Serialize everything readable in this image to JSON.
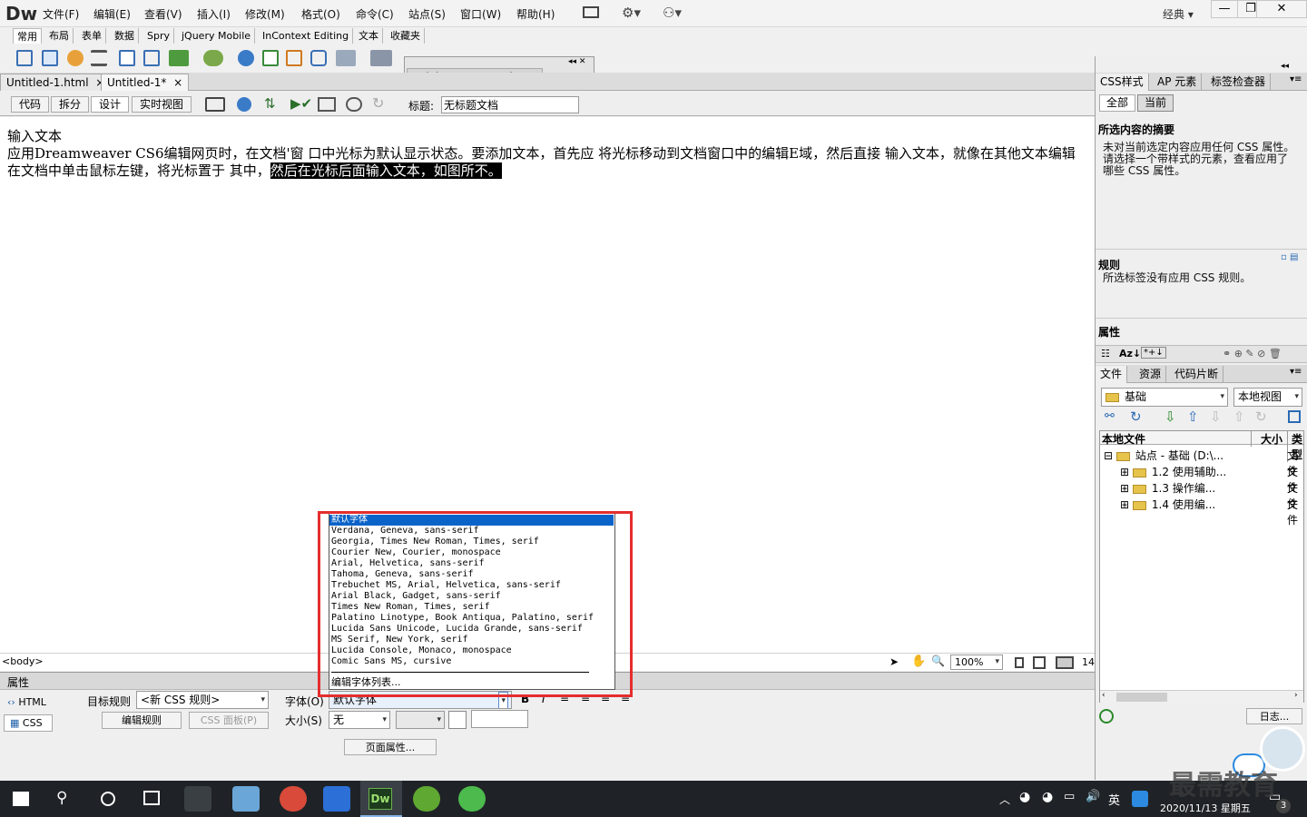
{
  "app": {
    "logo": "Dw",
    "workspace": "经典"
  },
  "menu": [
    "文件(F)",
    "编辑(E)",
    "查看(V)",
    "插入(I)",
    "修改(M)",
    "格式(O)",
    "命令(C)",
    "站点(S)",
    "窗口(W)",
    "帮助(H)"
  ],
  "insert_tabs": [
    "常用",
    "布局",
    "表单",
    "数据",
    "Spry",
    "jQuery Mobile",
    "InContext Editing",
    "文本",
    "收藏夹"
  ],
  "browserlab": "Adobe BrowserLab",
  "doc_tabs": [
    {
      "label": "Untitled-1.html",
      "close": "×"
    },
    {
      "label": "Untitled-1*",
      "close": "×"
    }
  ],
  "views": [
    "代码",
    "拆分",
    "设计",
    "实时视图"
  ],
  "title_label": "标题:",
  "title_value": "无标题文档",
  "document": {
    "line1": "输入文本",
    "line2": "应用Dreamweaver CS6编辑网页时，在文档'窗 口中光标为默认显示状态。要添加文本，首先应 将光标移动到文档窗口中的编辑E域，然后直接 输入文本，就像在其他文本编辑",
    "line3_a": "在文档中单击鼠标左键，将光标置于 其中，",
    "line3_selected": "然后在光标后面输入文本，如图所不。 "
  },
  "status": {
    "tag": "<body>",
    "zoom": "100%",
    "size": "14"
  },
  "properties": {
    "header": "属性",
    "html_btn": "HTML",
    "css_btn": "CSS",
    "target_rule_label": "目标规则",
    "target_rule_value": "<新 CSS 规则>",
    "edit_rule": "编辑规则",
    "css_panel": "CSS 面板(P)",
    "font_label": "字体(O)",
    "font_value": "默认字体",
    "size_label": "大小(S)",
    "size_value": "无",
    "page_props": "页面属性..."
  },
  "font_dropdown": {
    "selected": "默认字体",
    "options": [
      "Verdana, Geneva, sans-serif",
      "Georgia, Times New Roman, Times, serif",
      "Courier New, Courier, monospace",
      "Arial, Helvetica, sans-serif",
      "Tahoma, Geneva, sans-serif",
      "Trebuchet MS, Arial, Helvetica, sans-serif",
      "Arial Black, Gadget, sans-serif",
      "Times New Roman, Times, serif",
      "Palatino Linotype, Book Antiqua, Palatino, serif",
      "Lucida Sans Unicode, Lucida Grande, sans-serif",
      "MS Serif, New York, serif",
      "Lucida Console, Monaco, monospace",
      "Comic Sans MS, cursive"
    ],
    "edit_list": "编辑字体列表..."
  },
  "css_panel": {
    "tabs": [
      "CSS样式",
      "AP 元素",
      "标签检查器"
    ],
    "mode_tabs": [
      "全部",
      "当前"
    ],
    "summary_title": "所选内容的摘要",
    "summary_text": [
      "未对当前选定内容应用任何 CSS 属性。",
      "请选择一个带样式的元素，查看应用了",
      "哪些 CSS 属性。"
    ],
    "rules_title": "规则",
    "rules_text": "所选标签没有应用 CSS 规则。",
    "props_title": "属性"
  },
  "files_panel": {
    "tabs": [
      "文件",
      "资源",
      "代码片断"
    ],
    "site": "基础",
    "view": "本地视图",
    "cols": [
      "本地文件",
      "大小",
      "类型"
    ],
    "rows": [
      {
        "label": "站点 - 基础 (D:\\...",
        "type": "文件"
      },
      {
        "label": "1.2 使用辅助...",
        "type": "文件"
      },
      {
        "label": "1.3  操作编...",
        "type": "文件"
      },
      {
        "label": "1.4  使用编...",
        "type": "文件"
      }
    ],
    "log": "日志..."
  },
  "taskbar": {
    "ime": "英",
    "date": "2020/11/13 星期五",
    "badge": "3",
    "dw": "Dw"
  },
  "watermark": "最需教育",
  "colors": {
    "selection": "#0a63c9",
    "highlight": "#e52d2d",
    "taskbar": "#1f2327"
  }
}
